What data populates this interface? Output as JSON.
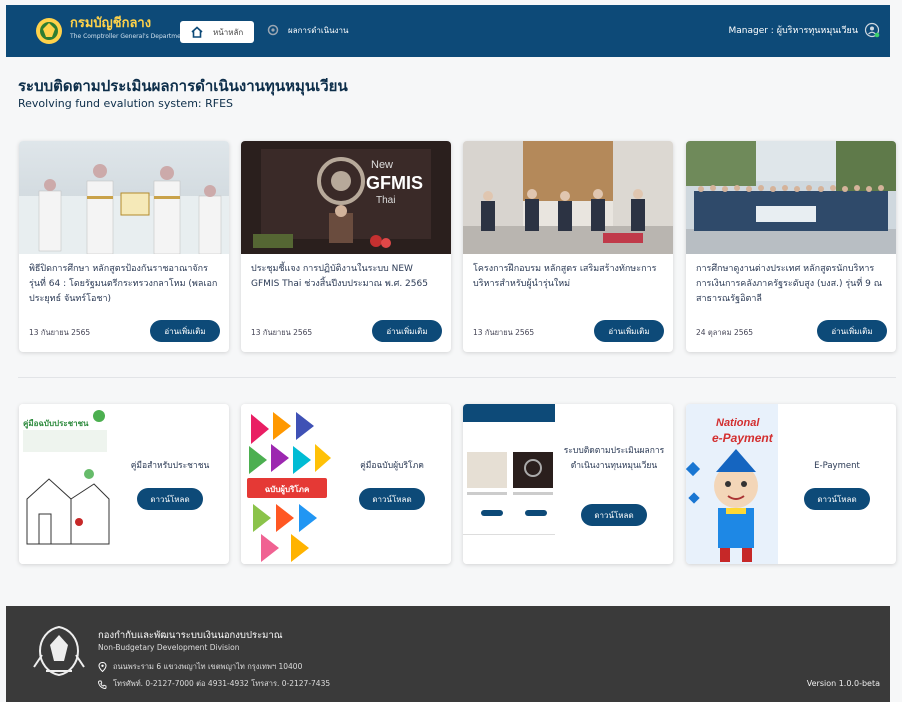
{
  "header": {
    "brand_title": "กรมบัญชีกลาง",
    "brand_sub": "The Comptroller General's Department",
    "nav_home": "หน้าหลัก",
    "nav_results": "ผลการดำเนินงาน",
    "user_label": "Manager : ผู้บริหารทุนหมุนเวียน"
  },
  "page": {
    "title": "ระบบติดตามประเมินผลการดำเนินงานทุนหมุนเวียน",
    "subtitle": "Revolving fund evalution system: RFES"
  },
  "news": [
    {
      "text": "พิธีปิดการศึกษา หลักสูตรป้องกันราชอาณาจักร รุ่นที่ 64 : โดยรัฐมนตรีกระทรวงกลาโหม (พลเอกประยุทธ์ จันทร์โอชา)",
      "date": "13 กันยายน 2565",
      "button": "อ่านเพิ่มเติม"
    },
    {
      "text": "ประชุมชี้แจง การปฏิบัติงานในระบบ NEW GFMIS Thai ช่วงสิ้นปีงบประมาณ พ.ศ. 2565",
      "date": "13 กันยายน 2565",
      "button": "อ่านเพิ่มเติม",
      "image_text_1": "New",
      "image_text_2": "GFMIS",
      "image_text_3": "Thai"
    },
    {
      "text": "โครงการฝึกอบรม หลักสูตร เสริมสร้างทักษะการบริหารสำหรับผู้นำรุ่นใหม่",
      "date": "13 กันยายน 2565",
      "button": "อ่านเพิ่มเติม"
    },
    {
      "text": "การศึกษาดูงานต่างประเทศ หลักสูตรนักบริหารการเงินการคลังภาครัฐระดับสูง (บงส.) รุ่นที่ 9 ณ สาธารณรัฐอิตาลี",
      "date": "24 ตุลาคม 2565",
      "button": "อ่านเพิ่มเติม"
    }
  ],
  "docs": [
    {
      "label": "คู่มือสำหรับประชาชน",
      "button": "ดาวน์โหลด",
      "cover_title": "คู่มือฉบับประชาชน"
    },
    {
      "label": "คู่มือฉบับผู้บริโภค",
      "button": "ดาวน์โหลด",
      "cover_title": "ฉบับผู้บริโภค"
    },
    {
      "label": "ระบบติดตามประเมินผลการดำเนินงานทุนหมุนเวียน",
      "button": "ดาวน์โหลด"
    },
    {
      "label": "E-Payment",
      "button": "ดาวน์โหลด",
      "cover_title_1": "National",
      "cover_title_2": "e-Payment"
    }
  ],
  "footer": {
    "title": "กองกำกับและพัฒนาระบบเงินนอกงบประมาณ",
    "subtitle": "Non-Budgetary Development Division",
    "address": "ถนนพระราม 6 แขวงพญาไท เขตพญาไท กรุงเทพฯ 10400",
    "phone": "โทรศัพท์. 0-2127-7000 ต่อ 4931-4932 โทรสาร. 0-2127-7435",
    "version": "Version 1.0.0-beta"
  },
  "colors": {
    "primary": "#0d4a78",
    "accent": "#ffd24a",
    "footer": "#3a3a3a"
  }
}
